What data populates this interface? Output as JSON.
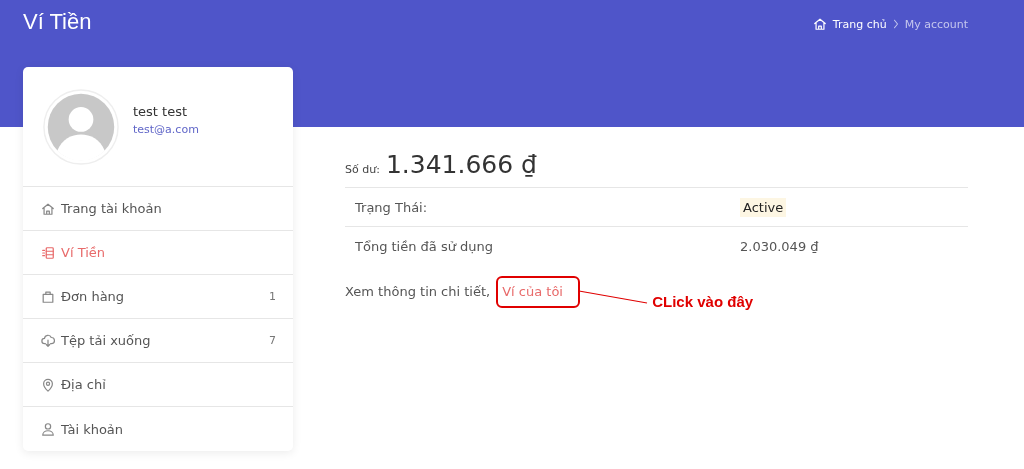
{
  "header": {
    "title": "Ví Tiền",
    "breadcrumb": [
      {
        "label": "Trang chủ",
        "selected": false
      },
      {
        "label": "My account",
        "selected": true
      }
    ]
  },
  "profile": {
    "name": "test test",
    "email": "test@a.com"
  },
  "sidebar": {
    "items": [
      {
        "label": "Trang tài khoản",
        "selected": false
      },
      {
        "label": "Ví Tiền",
        "selected": true
      },
      {
        "label": "Đơn hàng",
        "selected": false,
        "count": "1"
      },
      {
        "label": "Tệp tải xuống",
        "selected": false,
        "count": "7"
      },
      {
        "label": "Địa chỉ",
        "selected": false
      },
      {
        "label": "Tài khoản",
        "selected": false
      }
    ]
  },
  "balance": {
    "label": "Số dư:",
    "amount": "1.341.666 ₫"
  },
  "details": [
    {
      "label": "Trạng Thái:",
      "value": "Active",
      "kind": "badge"
    },
    {
      "label": "Tổng tiền đã sử dụng",
      "value": "2.030.049 ₫",
      "kind": "text"
    }
  ],
  "more": {
    "text": "Xem thông tin chi tiết,",
    "link": "Ví của tôi"
  },
  "annotation": {
    "label": "CLick vào đây"
  }
}
